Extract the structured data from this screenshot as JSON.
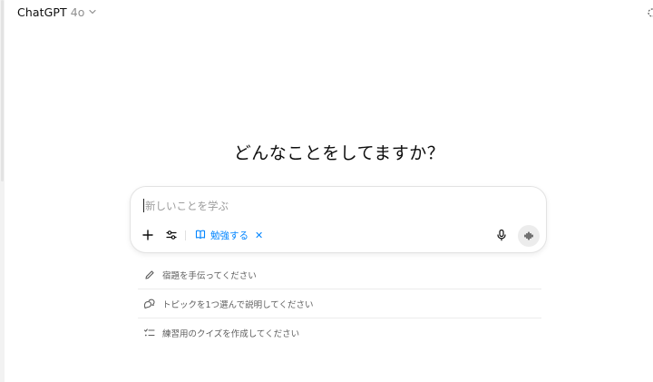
{
  "header": {
    "model_name": "ChatGPT",
    "model_version": "4o",
    "dropdown_icon": "chevron-down-icon"
  },
  "main": {
    "heading": "どんなことをしてますか？"
  },
  "composer": {
    "placeholder": "新しいことを学ぶ",
    "value": "",
    "plus_icon": "plus-icon",
    "tools_icon": "sliders-icon",
    "study_chip": {
      "icon": "book-open-icon",
      "label": "勉強する",
      "remove_icon": "close-icon"
    },
    "mic_icon": "microphone-icon",
    "voice_icon": "voice-mode-icon"
  },
  "suggestions": [
    {
      "icon": "pencil-icon",
      "label": "宿題を手伝ってください"
    },
    {
      "icon": "chat-bubbles-icon",
      "label": "トピックを1つ選んで説明してください"
    },
    {
      "icon": "checklist-icon",
      "label": "練習用のクイズを作成してください"
    }
  ],
  "colors": {
    "accent": "#0285ff",
    "text": "#0d0d0d",
    "muted": "#5d5d5d",
    "border": "#e3e3e3"
  }
}
